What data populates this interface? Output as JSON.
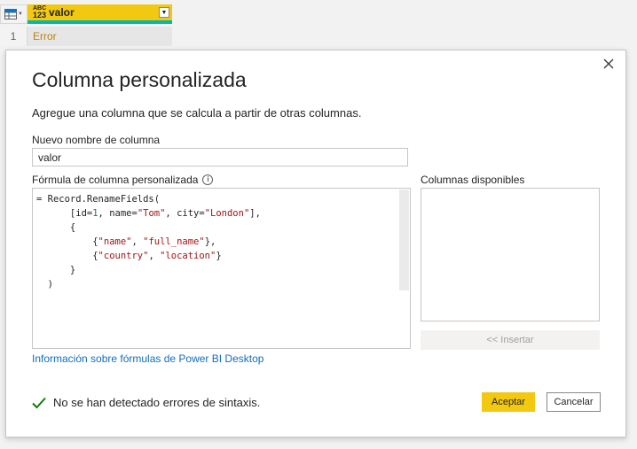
{
  "grid": {
    "column_type_top": "ABC",
    "column_type_bottom": "123",
    "column_name": "valor",
    "rows": [
      {
        "number": "1",
        "value": "Error"
      }
    ]
  },
  "dialog": {
    "title": "Columna personalizada",
    "subtitle": "Agregue una columna que se calcula a partir de otras columnas.",
    "new_column_label": "Nuevo nombre de columna",
    "new_column_value": "valor",
    "formula_label": "Fórmula de columna personalizada",
    "formula_lines": [
      "= Record.RenameFields(",
      "      [id=1, name=\"Tom\", city=\"London\"],",
      "      {",
      "          {\"name\", \"full_name\"},",
      "          {\"country\", \"location\"}",
      "      }",
      "  )"
    ],
    "formula_link": "Información sobre fórmulas de Power BI Desktop",
    "available_columns_label": "Columnas disponibles",
    "available_columns": [],
    "insert_label": "<< Insertar",
    "status_text": "No se han detectado errores de sintaxis.",
    "accept_label": "Aceptar",
    "cancel_label": "Cancelar"
  },
  "colors": {
    "accent": "#f2c811",
    "column_underline": "#01b8aa",
    "link": "#106ebe",
    "success": "#107c10",
    "error_text": "#b8860b"
  },
  "icons": {
    "table": "table-icon",
    "close": "close-icon",
    "info": "info-icon",
    "check": "check-icon",
    "dropdown": "chevron-down-icon"
  }
}
